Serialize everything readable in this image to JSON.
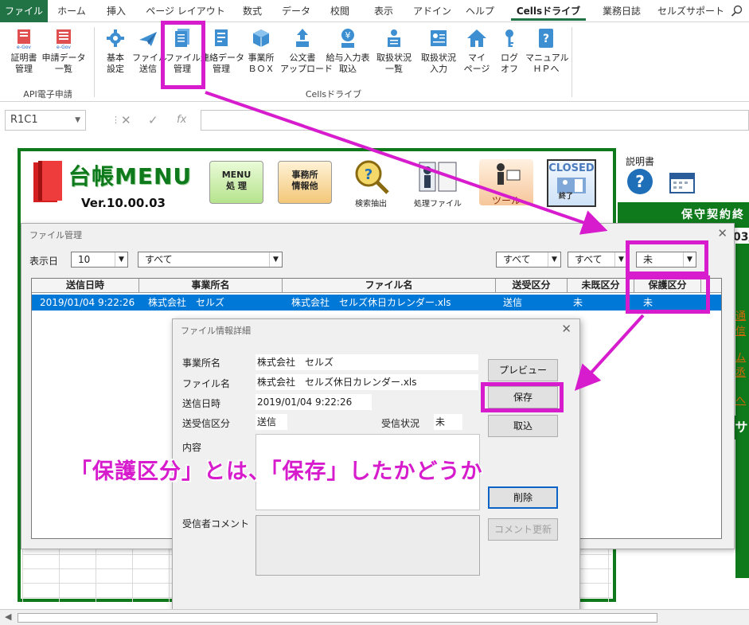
{
  "ribbon_tabs": [
    "ファイル",
    "ホーム",
    "挿入",
    "ページ レイアウト",
    "数式",
    "データ",
    "校閲",
    "表示",
    "アドイン",
    "ヘルプ",
    "Cellsドライブ",
    "業務日誌",
    "セルズサポート"
  ],
  "ribbon": {
    "api_group": {
      "label": "API電子申請",
      "buttons": [
        {
          "line1": "証明書",
          "line2": "管理",
          "icon": "certificate-icon"
        },
        {
          "line1": "申請データ",
          "line2": "一覧",
          "icon": "application-list-icon"
        }
      ]
    },
    "cells_group": {
      "label": "Cellsドライブ",
      "buttons": [
        {
          "line1": "基本",
          "line2": "設定",
          "icon": "settings-icon"
        },
        {
          "line1": "ファイル",
          "line2": "送信",
          "icon": "send-icon"
        },
        {
          "line1": "ファイル",
          "line2": "管理",
          "icon": "file-manage-icon"
        },
        {
          "line1": "連絡データ",
          "line2": "管理",
          "icon": "contact-data-icon"
        },
        {
          "line1": "事業所",
          "line2": "ＢＯＸ",
          "icon": "box-icon"
        },
        {
          "line1": "公文書",
          "line2": "アップロード",
          "icon": "upload-icon"
        },
        {
          "line1": "給与入力表",
          "line2": "取込",
          "icon": "salary-icon"
        },
        {
          "line1": "取扱状況",
          "line2": "一覧",
          "icon": "status-list-icon"
        },
        {
          "line1": "取扱状況",
          "line2": "入力",
          "icon": "status-input-icon"
        },
        {
          "line1": "マイ",
          "line2": "ページ",
          "icon": "home-icon"
        },
        {
          "line1": "ログ",
          "line2": "オフ",
          "icon": "key-icon"
        },
        {
          "line1": "マニュアル",
          "line2": "ＨＰへ",
          "icon": "manual-icon"
        }
      ]
    }
  },
  "formula_bar": {
    "name_box": "R1C1",
    "fx": "fx"
  },
  "banner": {
    "title": "台帳MENU",
    "version": "Ver.10.00.03",
    "menu_btn": {
      "line1": "MENU",
      "line2": "処 理"
    },
    "office_btn": {
      "line1": "事務所",
      "line2": "情報他"
    },
    "search_label": "検索抽出",
    "process_label": "処理ファイル",
    "tool_label": "ツール",
    "closed_label": "CLOSED",
    "closed_sub": "終了"
  },
  "right_panel": {
    "manual": "説明書",
    "band": "保守契約終",
    "date": "03/",
    "links": [
      "通信",
      "ム丞",
      "へ"
    ],
    "side_text": "サ"
  },
  "file_dialog": {
    "title": "ファイル管理",
    "display_days_label": "表示日",
    "display_days": "10",
    "filter_all": "すべて",
    "filter_send": "すべて",
    "filter_read": "すべて",
    "filter_protect": "未",
    "columns": [
      "送信日時",
      "事業所名",
      "ファイル名",
      "送受区分",
      "未既区分",
      "保護区分"
    ],
    "rows": [
      {
        "date": "2019/01/04 9:22:26",
        "office": "株式会社　セルズ",
        "file": "株式会社　セルズ休日カレンダー.xls",
        "direction": "送信",
        "read": "未",
        "protect": "未"
      }
    ]
  },
  "detail_dialog": {
    "title": "ファイル情報詳細",
    "office_label": "事業所名",
    "office": "株式会社　セルズ",
    "file_label": "ファイル名",
    "file": "株式会社　セルズ休日カレンダー.xls",
    "date_label": "送信日時",
    "date": "2019/01/04 9:22:26",
    "direction_label": "送受信区分",
    "direction": "送信",
    "status_label": "受信状況",
    "status": "未",
    "content_label": "内容",
    "comment_label": "受信者コメント",
    "btn_preview": "プレビュー",
    "btn_save": "保存",
    "btn_import": "取込",
    "btn_delete": "削除",
    "btn_comment": "コメント更新"
  },
  "annotation": {
    "caption": "「保護区分」とは、「保存」したかどうか",
    "highlight_color": "#d61ccc"
  },
  "colors": {
    "excel_green": "#217346",
    "frame_green": "#0f7a1c",
    "selection_blue": "#0078d7"
  }
}
